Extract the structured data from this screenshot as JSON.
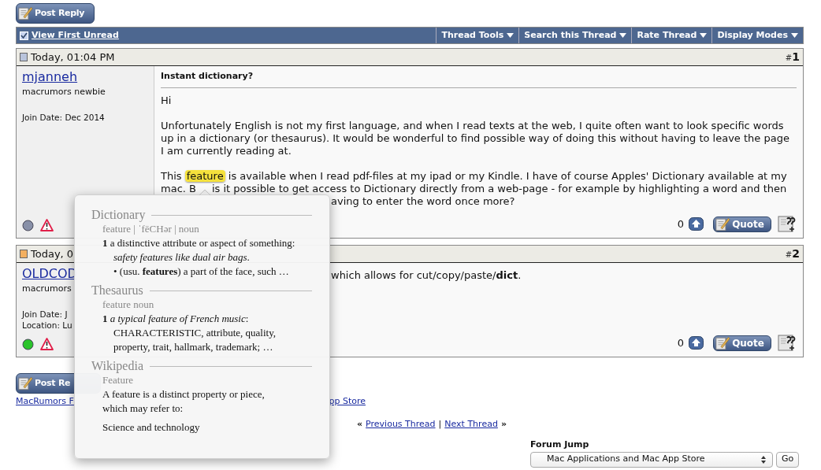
{
  "post_reply_top": "Post Reply",
  "toolbar": {
    "view_first_unread": "View First Unread",
    "menus": [
      "Thread Tools",
      "Search this Thread",
      "Rate Thread",
      "Display Modes"
    ]
  },
  "posts": [
    {
      "date": "Today, 01:04 PM",
      "new": false,
      "number_sign": "#",
      "number": "1",
      "author": "mjanneh",
      "rank": "macrumors newbie",
      "details": [
        "Join Date: Dec 2014"
      ],
      "online": false,
      "title": "Instant dictionary?",
      "paragraphs": [
        [
          {
            "kind": "full",
            "text": "Hi"
          }
        ],
        [
          {
            "kind": "full",
            "text": "Unfortunately English is not my first language, and when I read texts at the web, I quite often want to look specific words"
          },
          {
            "kind": "full",
            "text": "up in a dictionary (or thesaurus). It would be wonderful to find possible way of doing this without having to leave the page"
          },
          {
            "kind": "full",
            "text": "I am currently reading at."
          }
        ],
        [
          {
            "kind": "full",
            "segments": [
              {
                "text": "This ",
                "highlighted": false
              },
              {
                "text": "feature",
                "highlighted": true
              },
              {
                "text": " is available when I read pdf-files at my ipad or my Kindle. I have of course Apples' Dictionary available at my",
                "highlighted": false
              }
            ]
          },
          {
            "kind": "split",
            "segments": [
              {
                "text": "mac. B",
                "highlighted": false
              },
              {
                "text": "is it possible to get access to Dictionary directly from a web-page - for example by highlighting a word and then",
                "highlighted": false
              }
            ]
          },
          {
            "kind": "partial",
            "text": "aving to enter the word once more?"
          }
        ]
      ],
      "votes": "0",
      "quote": "Quote"
    },
    {
      "date": "Today, 0",
      "new": true,
      "number_sign": "#",
      "number": "2",
      "author": "OLDCOD",
      "rank": "macrumors",
      "details": [
        "Join Date: J",
        "Location: Lu"
      ],
      "online": true,
      "paragraphs": [
        [
          {
            "kind": "partial",
            "text": "which allows for cut/copy/paste/**dict**."
          }
        ]
      ],
      "votes": "0",
      "quote": "Quote"
    }
  ],
  "post_reply_bottom": "Post Re",
  "breadcrumb": [
    "MacRumors F",
    "pp Store"
  ],
  "thread_nav": {
    "left_mark": "«",
    "prev": "Previous Thread",
    "separator": "|",
    "next": "Next Thread",
    "right_mark": "»"
  },
  "forum_jump": {
    "label": "Forum Jump",
    "value": "Mac Applications and Mac App Store",
    "button": "Go"
  },
  "popup": {
    "sections": [
      {
        "heading": "Dictionary",
        "entry": "feature | ˈfēCHər | noun",
        "lines": [
          {
            "kind": "definition",
            "text": "**1** a distinctive attribute or aspect of something: *safety features like dual air bags*."
          },
          {
            "kind": "subsense",
            "text": "• (usu. **features**) a part of the face, such  …"
          }
        ]
      },
      {
        "heading": "Thesaurus",
        "entry": "feature noun",
        "lines": [
          {
            "kind": "definition",
            "text": "**1** *a typical feature of French music*:"
          },
          {
            "kind": "subsense",
            "text": "CHARACTERISTIC, attribute, quality, property, trait, hallmark, trademark;  …"
          }
        ]
      },
      {
        "heading": "Wikipedia",
        "entry": "Feature",
        "lines": [
          {
            "kind": "plain",
            "text": "A feature is a distinct property or piece, which may refer to:"
          },
          {
            "kind": "plain",
            "text": "Science and technology"
          }
        ]
      }
    ]
  }
}
